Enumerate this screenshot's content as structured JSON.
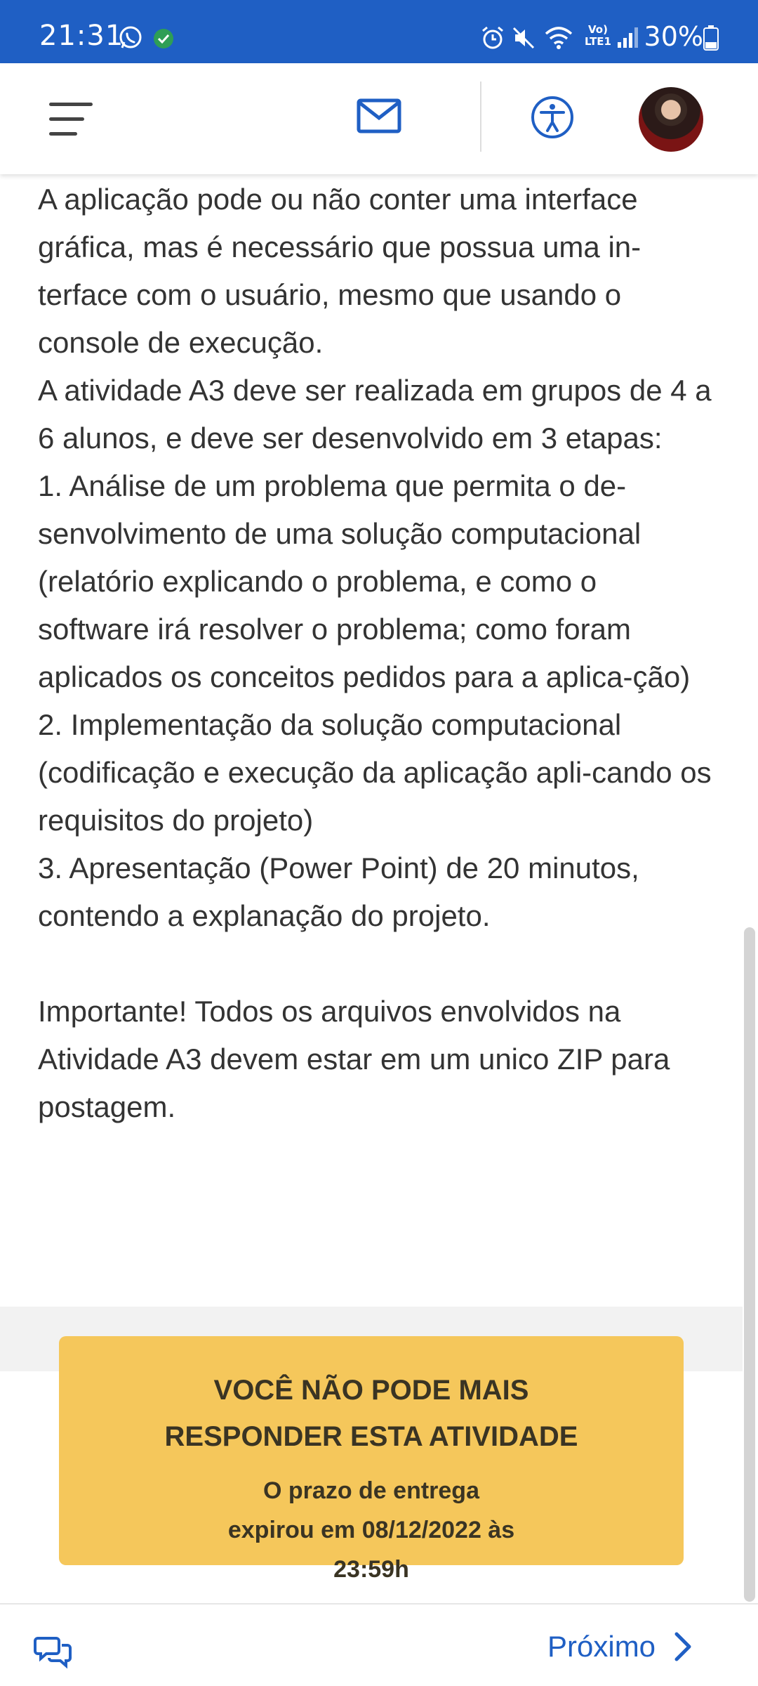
{
  "status_bar": {
    "time": "21:31",
    "battery": "30%",
    "icons": [
      "whatsapp-icon",
      "verified-icon",
      "alarm-icon",
      "mute-icon",
      "wifi-icon",
      "volte-icon",
      "signal-icon",
      "battery-icon"
    ],
    "volte_label": "Vo)\nLTE1"
  },
  "app_bar": {
    "icons": [
      "menu-icon",
      "mail-icon",
      "accessibility-icon",
      "avatar"
    ],
    "accent_color": "#1f5fc4"
  },
  "content": {
    "paragraphs": [
      "A aplicação pode ou não conter uma interface gráfica, mas é necessário que possua uma in-terface com o usuário, mesmo que usando o console de execução.",
      "A atividade A3 deve ser realizada em grupos de 4 a 6 alunos, e deve ser desenvolvido em 3 etapas:",
      "1. Análise de um problema que permita o de-senvolvimento de uma solução computacional (relatório explicando o problema, e como o software irá resolver o problema; como foram aplicados os conceitos pedidos para a aplica-ção)",
      "2. Implementação da solução computacional (codificação e execução da aplicação apli-cando os requisitos do projeto)",
      "3. Apresentação (Power Point) de 20 minutos, contendo a explanação do projeto.",
      "Importante! Todos os arquivos envolvidos na Atividade A3 devem estar em um unico ZIP para postagem."
    ]
  },
  "warning": {
    "title": "VOCÊ NÃO PODE MAIS RESPONDER ESTA ATIVIDADE",
    "subtitle": "O prazo de entrega expirou em 08/12/2022 às 23:59h",
    "background_color": "#f5c75b"
  },
  "bottom_bar": {
    "next_label": "Próximo"
  }
}
